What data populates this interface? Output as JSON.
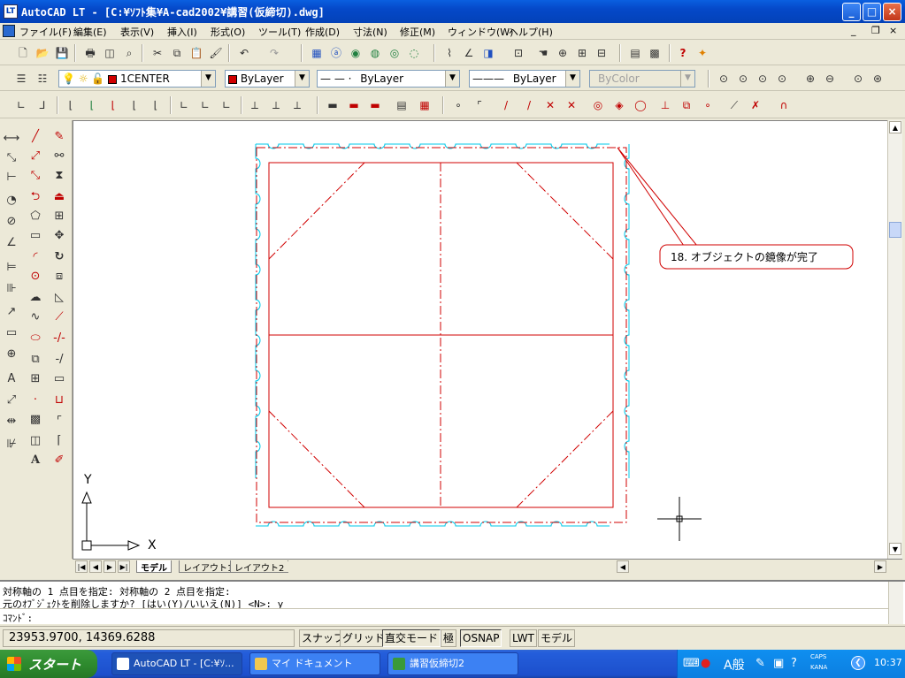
{
  "window": {
    "title": "AutoCAD LT - [C:¥ｿﾌﾄ集¥A-cad2002¥講習(仮締切).dwg]",
    "app_icon": "LT"
  },
  "menu": [
    "ファイル(F)",
    "編集(E)",
    "表示(V)",
    "挿入(I)",
    "形式(O)",
    "ツール(T)",
    "作成(D)",
    "寸法(N)",
    "修正(M)",
    "ウィンドウ(W)",
    "ヘルプ(H)"
  ],
  "layer_toolbar": {
    "layer": "1CENTER",
    "color": "ByLayer",
    "linetype": "ByLayer",
    "lineweight": "ByLayer",
    "plotstyle": "ByColor",
    "linetype_sample": "— — ·",
    "lineweight_sample": "———"
  },
  "annotation": "18. オブジェクトの鏡像が完了",
  "ucs": {
    "x": "X",
    "y": "Y"
  },
  "tabs": [
    "モデル",
    "レイアウト1",
    "レイアウト2"
  ],
  "nav_arrows": [
    "|◀",
    "◀",
    "▶",
    "▶|"
  ],
  "command": {
    "line1": "対称軸の 1 点目を指定: 対称軸の 2 点目を指定:",
    "line2": "元のｵﾌﾞｼﾞｪｸﾄを削除しますか? [はい(Y)/いいえ(N)] <N>: y",
    "prompt": "ｺﾏﾝﾄﾞ:"
  },
  "status": {
    "coords": "23953.9700, 14369.6288",
    "buttons": [
      "スナップ",
      "グリッド",
      "直交モード",
      "極",
      "OSNAP",
      "LWT",
      "モデル"
    ]
  },
  "taskbar": {
    "start": "スタート",
    "items": [
      "AutoCAD LT - [C:¥ｿ...",
      "マイ ドキュメント",
      "講習仮締切2"
    ],
    "ime": "A般",
    "caps": "CAPS",
    "kana": "KANA",
    "clock": "10:37"
  },
  "colors": {
    "drawing_red": "#d00000",
    "drawing_cyan": "#00c8e8",
    "titlebar": "#0548c8"
  },
  "icons": {
    "standard": [
      "new-icon",
      "open-icon",
      "save-icon",
      "print-icon",
      "preview-icon",
      "find-icon",
      "cut-icon",
      "copy-icon",
      "paste-icon",
      "matchprop-icon",
      "undo-icon",
      "redo-icon",
      "properties-icon",
      "designcenter-icon",
      "web-icon",
      "pan-icon",
      "zoom-realtime-icon",
      "help-icon"
    ],
    "draw": [
      "line-icon",
      "xline-icon",
      "polyline-icon",
      "polygon-icon",
      "rectangle-icon",
      "arc-icon",
      "circle-icon",
      "cloud-icon",
      "spline-icon",
      "ellipse-icon",
      "insert-icon",
      "block-icon",
      "point-icon",
      "hatch-icon",
      "region-icon",
      "text-icon"
    ],
    "modify": [
      "erase-icon",
      "copy-obj-icon",
      "mirror-icon",
      "offset-icon",
      "array-icon",
      "move-icon",
      "rotate-icon",
      "scale-icon",
      "stretch-icon",
      "trim-icon",
      "extend-icon",
      "break-icon",
      "chamfer-icon",
      "fillet-icon",
      "explode-icon"
    ]
  }
}
